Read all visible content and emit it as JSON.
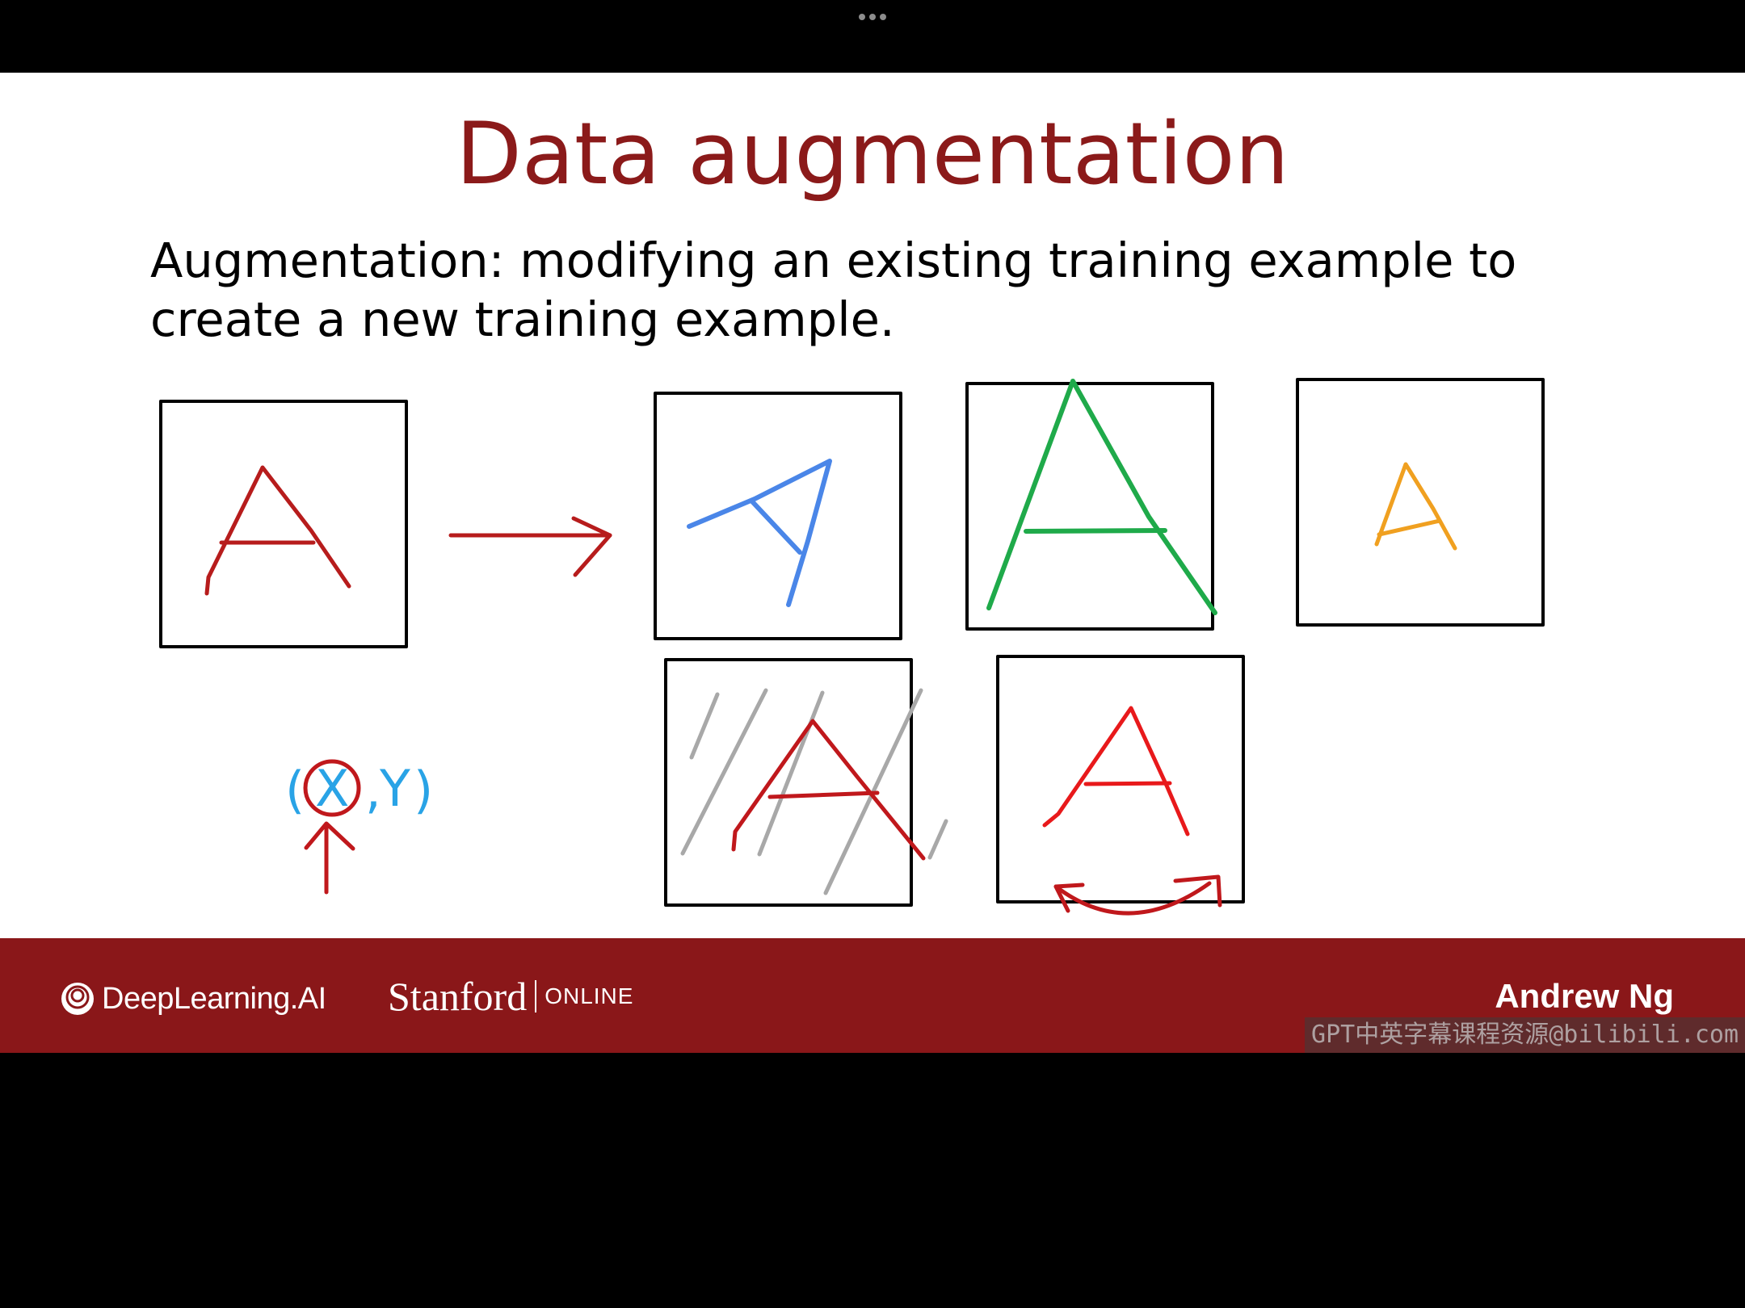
{
  "window": {
    "menu_icon": "more-horizontal-icon"
  },
  "slide": {
    "title": "Data augmentation",
    "definition_line1": "Augmentation: modifying an existing training example to",
    "definition_line2": "create a new training example.",
    "annotation": {
      "paren_open": "(",
      "x_letter": "X",
      "comma": ",",
      "y_letter": "Y",
      "paren_close": ")"
    },
    "letter": "A",
    "colors": {
      "title": "#8b1a1a",
      "original_letter": "#b71c1c",
      "rotated_letter": "#4a86e8",
      "enlarged_letter": "#1faa4a",
      "shrunk_letter": "#f0a020",
      "distorted_letter": "#c0181c",
      "noise_strokes": "#a8a8a8",
      "flipped_letter": "#e8191b",
      "annotation_blue": "#29a3e6"
    }
  },
  "footer": {
    "brand_left": "DeepLearning.AI",
    "brand_middle": "Stanford",
    "brand_middle_suffix": "ONLINE",
    "presenter": "Andrew Ng",
    "background": "#8a1719"
  },
  "watermark": "GPT中英字幕课程资源@bilibili.com"
}
